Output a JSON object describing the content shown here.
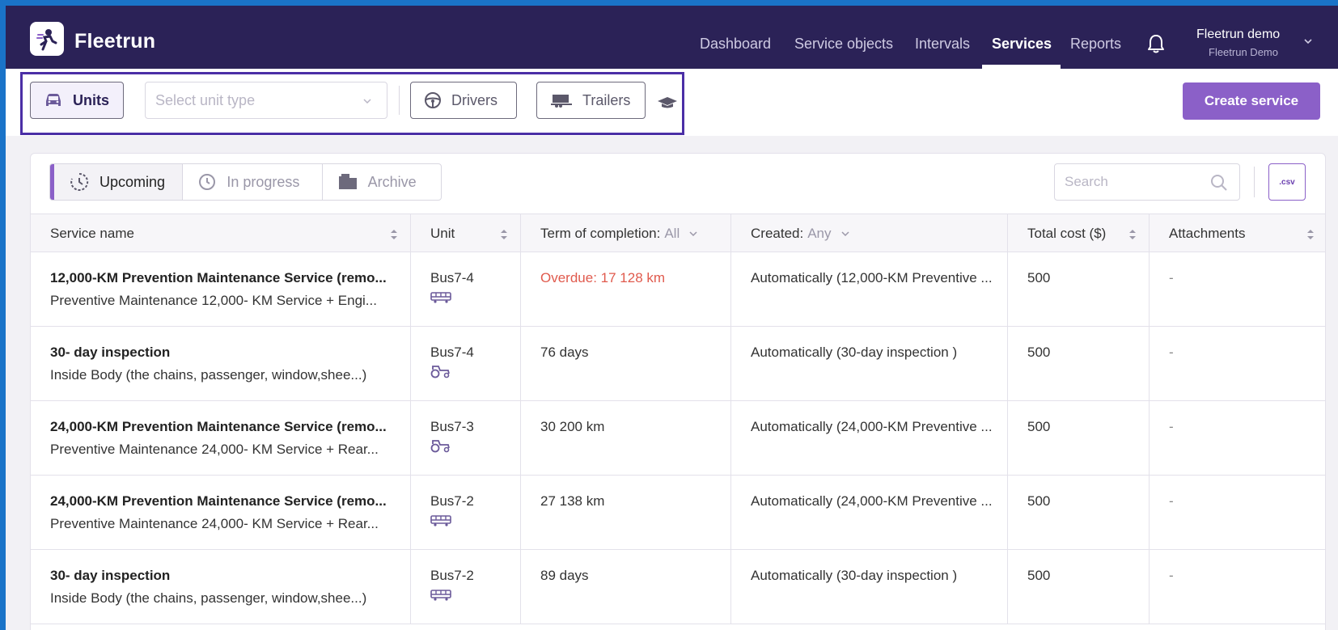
{
  "app": {
    "brand": "Fleetrun"
  },
  "nav": {
    "items": [
      "Dashboard",
      "Service objects",
      "Intervals",
      "Services",
      "Reports"
    ],
    "active": "Services"
  },
  "user": {
    "name": "Fleetrun demo",
    "account": "Fleetrun Demo"
  },
  "filters": {
    "units_label": "Units",
    "unit_type_placeholder": "Select unit type",
    "drivers_label": "Drivers",
    "trailers_label": "Trailers",
    "create_label": "Create service"
  },
  "tabs": {
    "upcoming": "Upcoming",
    "in_progress": "In progress",
    "archive": "Archive"
  },
  "search": {
    "placeholder": "Search"
  },
  "csv_label": ".csv",
  "table": {
    "headers": {
      "service_name": "Service name",
      "unit": "Unit",
      "term": "Term of completion:",
      "term_value": "All",
      "created": "Created:",
      "created_value": "Any",
      "total_cost": "Total cost ($)",
      "attachments": "Attachments"
    },
    "rows": [
      {
        "title": "12,000-KM Prevention Maintenance Service (remo...",
        "subtitle": "Preventive Maintenance 12,000- KM Service + Engi...",
        "unit": "Bus7-4",
        "unit_icon": "bus-icon",
        "term": "Overdue: 17 128 km",
        "overdue": true,
        "created": "Automatically (12,000-KM Preventive ...",
        "cost": "500",
        "attachments": "-"
      },
      {
        "title": "30- day inspection",
        "subtitle": "Inside Body (the chains, passenger, window,shee...)",
        "unit": "Bus7-4",
        "unit_icon": "tractor-icon",
        "term": "76 days",
        "overdue": false,
        "created": "Automatically (30-day inspection )",
        "cost": "500",
        "attachments": "-"
      },
      {
        "title": "24,000-KM Prevention Maintenance Service (remo...",
        "subtitle": "Preventive Maintenance 24,000- KM Service + Rear...",
        "unit": "Bus7-3",
        "unit_icon": "tractor-icon",
        "term": "30 200 km",
        "overdue": false,
        "created": "Automatically (24,000-KM Preventive ...",
        "cost": "500",
        "attachments": "-"
      },
      {
        "title": "24,000-KM Prevention Maintenance Service (remo...",
        "subtitle": "Preventive Maintenance 24,000- KM Service + Rear...",
        "unit": "Bus7-2",
        "unit_icon": "bus-icon",
        "term": "27 138 km",
        "overdue": false,
        "created": "Automatically (24,000-KM Preventive ...",
        "cost": "500",
        "attachments": "-"
      },
      {
        "title": "30- day inspection",
        "subtitle": "Inside Body (the chains, passenger, window,shee...)",
        "unit": "Bus7-2",
        "unit_icon": "bus-icon",
        "term": "89 days",
        "overdue": false,
        "created": "Automatically (30-day inspection )",
        "cost": "500",
        "attachments": "-"
      }
    ]
  },
  "colors": {
    "nav_bg": "#2b2257",
    "accent": "#8b60c8",
    "overdue": "#e05a4d",
    "highlight_border": "#4b2fa6"
  }
}
